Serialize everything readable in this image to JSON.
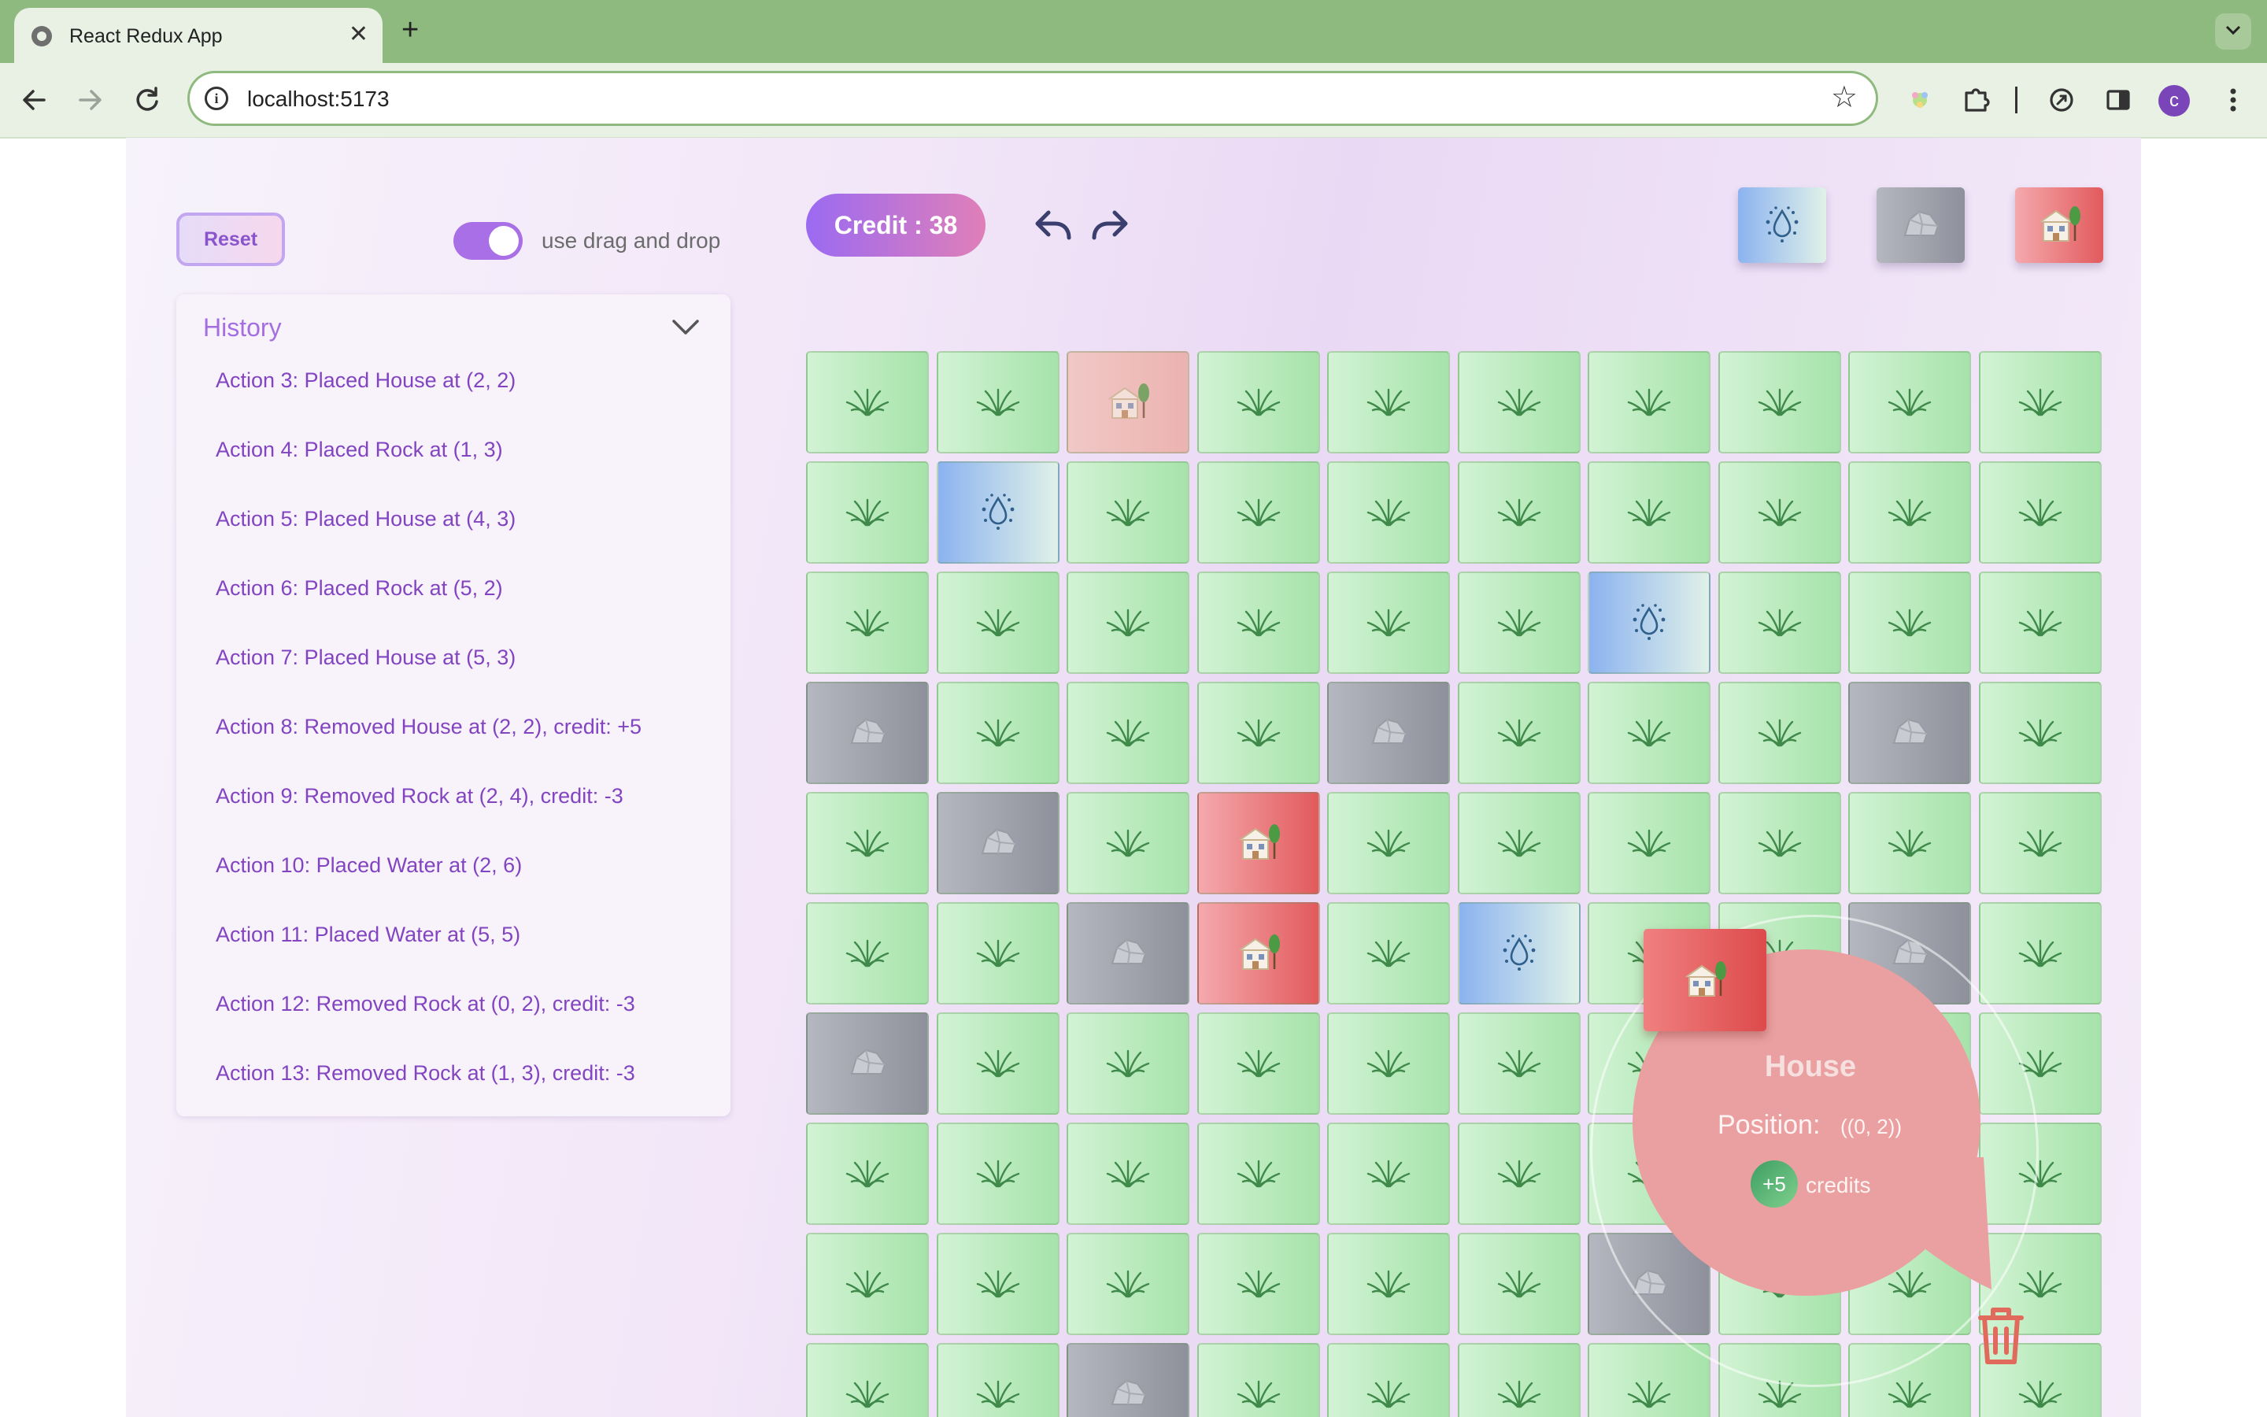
{
  "browser": {
    "tab_title": "React Redux App",
    "tab_close": "✕",
    "new_tab": "+",
    "url": "localhost:5173",
    "star": "☆",
    "profile_initial": "c"
  },
  "controls": {
    "reset_label": "Reset",
    "toggle_label": "use drag and drop",
    "toggle_on": true
  },
  "credit": {
    "label": "Credit : 38"
  },
  "history": {
    "title": "History",
    "items": [
      "Action 3: Placed House at (2, 2)",
      "Action 4: Placed Rock at (1, 3)",
      "Action 5: Placed House at (4, 3)",
      "Action 6: Placed Rock at (5, 2)",
      "Action 7: Placed House at (5, 3)",
      "Action 8: Removed House at (2, 2), credit: +5",
      "Action 9: Removed Rock at (2, 4), credit: -3",
      "Action 10: Placed Water at (2, 6)",
      "Action 11: Placed Water at (5, 5)",
      "Action 12: Removed Rock at (0, 2), credit: -3",
      "Action 13: Removed Rock at (1, 3), credit: -3"
    ]
  },
  "palette": [
    "water",
    "rock",
    "house"
  ],
  "grid": {
    "rows": [
      [
        "grass",
        "grass",
        "house-light",
        "grass",
        "grass",
        "grass",
        "grass",
        "grass",
        "grass",
        "grass"
      ],
      [
        "grass",
        "water",
        "grass",
        "grass",
        "grass",
        "grass",
        "grass",
        "grass",
        "grass",
        "grass"
      ],
      [
        "grass",
        "grass",
        "grass",
        "grass",
        "grass",
        "grass",
        "water",
        "grass",
        "grass",
        "grass"
      ],
      [
        "rock",
        "grass",
        "grass",
        "grass",
        "rock",
        "grass",
        "grass",
        "grass",
        "rock",
        "grass"
      ],
      [
        "grass",
        "rock",
        "grass",
        "house",
        "grass",
        "grass",
        "grass",
        "grass",
        "grass",
        "grass"
      ],
      [
        "grass",
        "grass",
        "rock",
        "house",
        "grass",
        "water",
        "grass",
        "grass",
        "rock",
        "grass"
      ],
      [
        "rock",
        "grass",
        "grass",
        "grass",
        "grass",
        "grass",
        "grass",
        "grass",
        "grass",
        "grass"
      ],
      [
        "grass",
        "grass",
        "grass",
        "grass",
        "grass",
        "grass",
        "grass",
        "grass",
        "grass",
        "grass"
      ],
      [
        "grass",
        "grass",
        "grass",
        "grass",
        "grass",
        "grass",
        "rock",
        "grass",
        "grass",
        "grass"
      ],
      [
        "grass",
        "grass",
        "rock",
        "grass",
        "grass",
        "grass",
        "grass",
        "grass",
        "grass",
        "grass"
      ]
    ]
  },
  "popup": {
    "title": "House",
    "position_label": "Position:",
    "position_value": "((0, 2))",
    "badge": "+5",
    "credits_label": "credits"
  },
  "icons": {
    "grass": "grass-icon",
    "water": "water-drop-icon",
    "rock": "rock-icon",
    "house": "house-icon",
    "undo": "undo-icon",
    "redo": "redo-icon",
    "trash": "trash-icon",
    "chevron": "chevron-down-icon"
  },
  "colors": {
    "accent_purple": "#a46ee0",
    "history_text": "#8244c0",
    "credit_gradient_start": "#9b6af2",
    "credit_gradient_end": "#e07fb8",
    "popup_bg": "#eaa0a0",
    "trash": "#e06b5c"
  }
}
